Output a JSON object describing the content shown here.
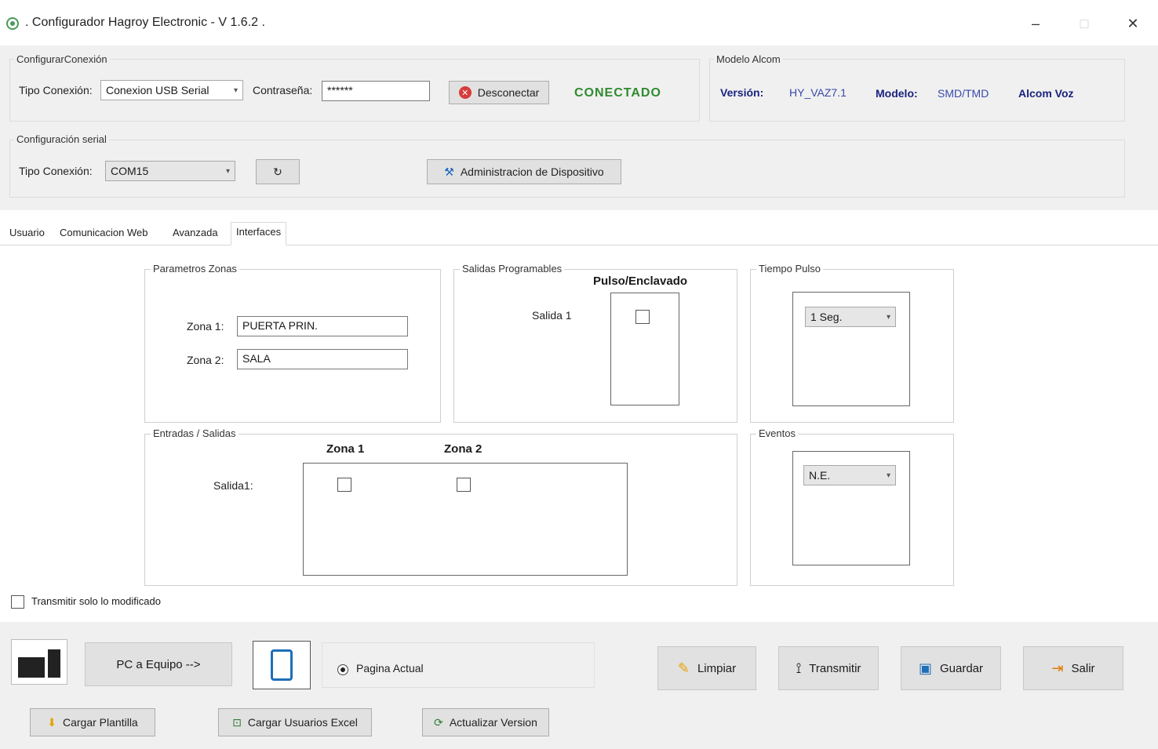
{
  "window": {
    "title": ". Configurador Hagroy Electronic - V 1.6.2 ."
  },
  "conexion": {
    "group_label": "ConfigurarConexión",
    "tipo_label": "Tipo Conexión:",
    "tipo_value": "Conexion USB Serial",
    "password_label": "Contraseña:",
    "password_value": "******",
    "disconnect_label": "Desconectar",
    "status": "CONECTADO"
  },
  "modelo": {
    "group_label": "Modelo Alcom",
    "version_label": "Versión:",
    "version_value": "HY_VAZ7.1",
    "modelo_label": "Modelo:",
    "modelo_value": "SMD/TMD",
    "product": "Alcom Voz"
  },
  "serial": {
    "group_label": "Configuración serial",
    "tipo_label": "Tipo Conexión:",
    "port_value": "COM15",
    "refresh_label": "↻",
    "admin_label": "Administracion de Dispositivo"
  },
  "tabs": [
    "Usuario",
    "Comunicacion Web",
    "Avanzada",
    "Interfaces"
  ],
  "interfaces": {
    "zonas": {
      "group_label": "Parametros Zonas",
      "zona1_label": "Zona 1:",
      "zona1_value": "PUERTA PRIN.",
      "zona2_label": "Zona 2:",
      "zona2_value": "SALA"
    },
    "salidas": {
      "group_label": "Salidas Programables",
      "column_header": "Pulso/Enclavado",
      "salida1_label": "Salida 1"
    },
    "tiempo": {
      "group_label": "Tiempo Pulso",
      "value": "1 Seg."
    },
    "entradas": {
      "group_label": "Entradas / Salidas",
      "col_zona1": "Zona 1",
      "col_zona2": "Zona 2",
      "row_label": "Salida1:"
    },
    "eventos": {
      "group_label": "Eventos",
      "value": "N.E."
    }
  },
  "transmit_only_modified": "Transmitir solo lo modificado",
  "bottom": {
    "direction_label": "PC a Equipo -->",
    "page_radio_label": "Pagina Actual",
    "limpiar": "Limpiar",
    "transmitir": "Transmitir",
    "guardar": "Guardar",
    "salir": "Salir",
    "cargar_plantilla": "Cargar Plantilla",
    "cargar_excel": "Cargar Usuarios Excel",
    "actualizar": "Actualizar Version"
  },
  "colors": {
    "status_green": "#2f8a2f",
    "info_navy": "#1a237e",
    "panel_gray": "#f0f0f0"
  }
}
